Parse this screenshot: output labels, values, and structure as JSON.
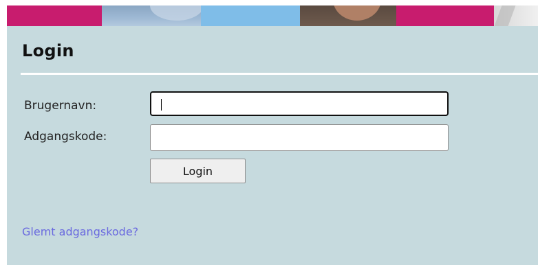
{
  "login": {
    "title": "Login",
    "username_label": "Brugernavn:",
    "username_value": "",
    "password_label": "Adgangskode:",
    "password_value": "",
    "submit_label": "Login",
    "forgot_link": "Glemt adgangskode?"
  },
  "colors": {
    "panel_background": "#c6dade",
    "banner_magenta": "#c81c6e",
    "link": "#6a6adf"
  }
}
